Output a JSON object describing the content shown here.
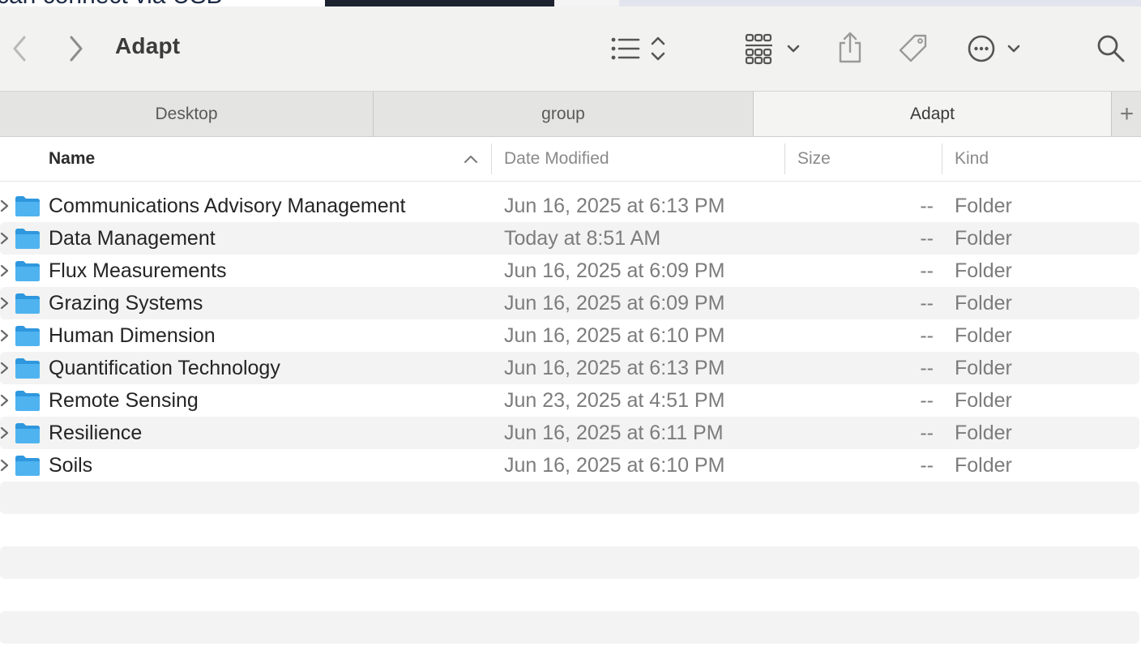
{
  "background": {
    "partial_text": "can connect via USB"
  },
  "toolbar": {
    "title": "Adapt",
    "back_icon": "chevron-left-icon",
    "forward_icon": "chevron-right-icon",
    "view_icon": "list-view-icon",
    "group_icon": "grid-group-icon",
    "share_icon": "share-icon",
    "tag_icon": "tag-icon",
    "more_icon": "ellipsis-circle-icon",
    "search_icon": "search-icon"
  },
  "tabs": [
    {
      "label": "Desktop",
      "active": false
    },
    {
      "label": "group",
      "active": false
    },
    {
      "label": "Adapt",
      "active": true
    }
  ],
  "tab_add_label": "+",
  "columns": {
    "name": "Name",
    "date": "Date Modified",
    "size": "Size",
    "kind": "Kind"
  },
  "rows": [
    {
      "name": "Communications Advisory Management",
      "date": "Jun 16, 2025 at 6:13 PM",
      "size": "--",
      "kind": "Folder"
    },
    {
      "name": "Data Management",
      "date": "Today at 8:51 AM",
      "size": "--",
      "kind": "Folder"
    },
    {
      "name": "Flux Measurements",
      "date": "Jun 16, 2025 at 6:09 PM",
      "size": "--",
      "kind": "Folder"
    },
    {
      "name": "Grazing Systems",
      "date": "Jun 16, 2025 at 6:09 PM",
      "size": "--",
      "kind": "Folder"
    },
    {
      "name": "Human Dimension",
      "date": "Jun 16, 2025 at 6:10 PM",
      "size": "--",
      "kind": "Folder"
    },
    {
      "name": "Quantification Technology",
      "date": "Jun 16, 2025 at 6:13 PM",
      "size": "--",
      "kind": "Folder"
    },
    {
      "name": "Remote Sensing",
      "date": "Jun 23, 2025 at 4:51 PM",
      "size": "--",
      "kind": "Folder"
    },
    {
      "name": "Resilience",
      "date": "Jun 16, 2025 at 6:11 PM",
      "size": "--",
      "kind": "Folder"
    },
    {
      "name": "Soils",
      "date": "Jun 16, 2025 at 6:10 PM",
      "size": "--",
      "kind": "Folder"
    }
  ],
  "colors": {
    "folder": "#4fb3f0",
    "folder_dark": "#2f97de",
    "toolbar_bg": "#f2f2f1",
    "row_alt": "#f2f3f2"
  }
}
